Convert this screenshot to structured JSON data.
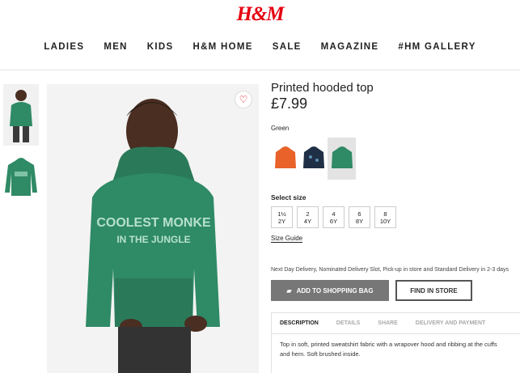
{
  "header": {
    "logo": "H&M",
    "nav": [
      "LADIES",
      "MEN",
      "KIDS",
      "H&M HOME",
      "SALE",
      "MAGAZINE",
      "#HM GALLERY"
    ]
  },
  "product": {
    "title": "Printed hooded top",
    "price": "£7.99",
    "color_label": "Green",
    "hoodie_print_line1": "COOLEST MONKE",
    "hoodie_print_line2": "IN THE JUNGLE",
    "size_label": "Select size",
    "sizes": [
      {
        "top": "1½",
        "bottom": "2Y"
      },
      {
        "top": "2",
        "bottom": "4Y"
      },
      {
        "top": "4",
        "bottom": "6Y"
      },
      {
        "top": "6",
        "bottom": "8Y"
      },
      {
        "top": "8",
        "bottom": "10Y"
      }
    ],
    "size_guide": "Size Guide",
    "delivery": "Next Day Delivery, Nominated Delivery Slot, Pick-up in store and Standard Delivery in 2-3 days",
    "add_to_bag": "ADD TO SHOPPING BAG",
    "find_in_store": "FIND IN STORE",
    "tabs": [
      "DESCRIPTION",
      "DETAILS",
      "SHARE",
      "DELIVERY AND PAYMENT"
    ],
    "description_line1": "Top in soft, printed sweatshirt fabric with a wrapover hood and ribbing at the cuffs",
    "description_line2": "and hem. Soft brushed inside."
  },
  "colors": {
    "brand": "#e50010",
    "hoodie_green": "#2f8a66",
    "swatch_orange": "#e8622a",
    "swatch_navy": "#1f2f45"
  }
}
